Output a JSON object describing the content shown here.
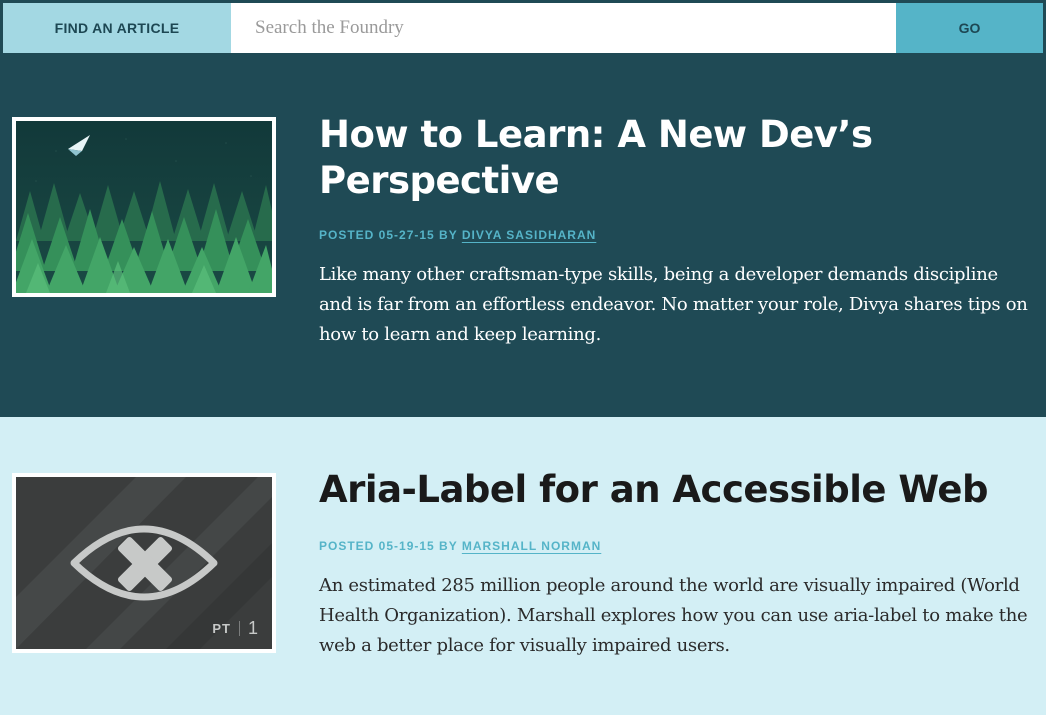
{
  "search": {
    "label": "FIND AN ARTICLE",
    "placeholder": "Search the Foundry",
    "value": "",
    "button_label": "GO"
  },
  "articles": [
    {
      "title": "How to Learn: A New Dev’s Perspective",
      "posted_prefix": "POSTED 05-27-15 BY",
      "author": "DIVYA SASIDHARAN",
      "excerpt": "Like many other craftsman-type skills, being a developer demands discipline and is far from an effortless endeavor. No matter your role, Divya shares tips on how to learn and keep learning.",
      "thumbnail": "forest-paper-plane-illustration"
    },
    {
      "title": "Aria-Label for an Accessible Web",
      "posted_prefix": "POSTED 05-19-15 BY",
      "author": "MARSHALL NORMAN",
      "excerpt": "An estimated 285 million people around the world are visually impaired (World Health Organization). Marshall explores how you can use aria-label to make the web a better place for visually impaired users.",
      "thumbnail": "crossed-eye-illustration",
      "thumbnail_badge": {
        "prefix": "PT",
        "number": "1"
      }
    }
  ],
  "colors": {
    "dark_background": "#1f4a55",
    "light_background": "#d3eff5",
    "accent": "#55b4c8",
    "label_background": "#a3d8e3"
  }
}
